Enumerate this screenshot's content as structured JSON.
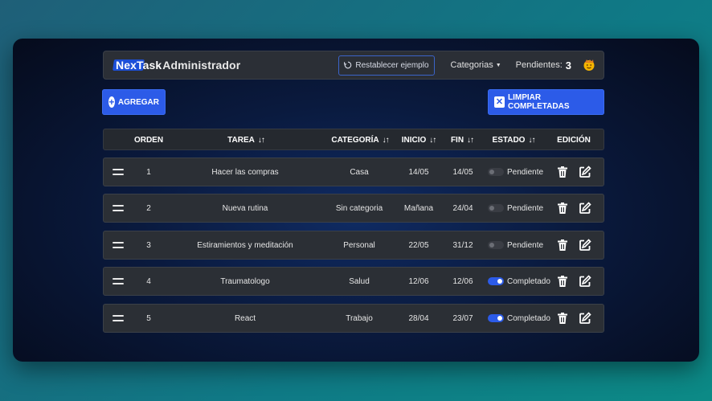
{
  "navbar": {
    "brand_prefix": "NexTask",
    "brand_suffix": " Administrador",
    "reset_label": "Restablecer ejemplo",
    "categories_label": "Categorias",
    "pending_label": "Pendientes:",
    "pending_count": "3",
    "avatar_icon": "emoji-face-icon"
  },
  "actions": {
    "add_label": "AGREGAR",
    "clear_label": "LIMPIAR COMPLETADAS"
  },
  "table": {
    "headers": {
      "order": "ORDEN",
      "task": "TAREA",
      "category": "CATEGORÍA",
      "start": "INICIO",
      "end": "FIN",
      "status": "ESTADO",
      "edit": "EDICIÓN"
    },
    "sort_glyph": "↓↑",
    "rows": [
      {
        "order": "1",
        "task": "Hacer las compras",
        "category": "Casa",
        "start": "14/05",
        "end": "14/05",
        "status": "Pendiente",
        "done": false
      },
      {
        "order": "2",
        "task": "Nueva rutina",
        "category": "Sin categoria",
        "start": "Mañana",
        "end": "24/04",
        "status": "Pendiente",
        "done": false
      },
      {
        "order": "3",
        "task": "Estiramientos y meditación",
        "category": "Personal",
        "start": "22/05",
        "end": "31/12",
        "status": "Pendiente",
        "done": false
      },
      {
        "order": "4",
        "task": "Traumatologo",
        "category": "Salud",
        "start": "12/06",
        "end": "12/06",
        "status": "Completado",
        "done": true
      },
      {
        "order": "5",
        "task": "React",
        "category": "Trabajo",
        "start": "28/04",
        "end": "23/07",
        "status": "Completado",
        "done": true
      }
    ]
  },
  "colors": {
    "accent": "#2c5be8",
    "row_bg": "#2b2f35"
  }
}
